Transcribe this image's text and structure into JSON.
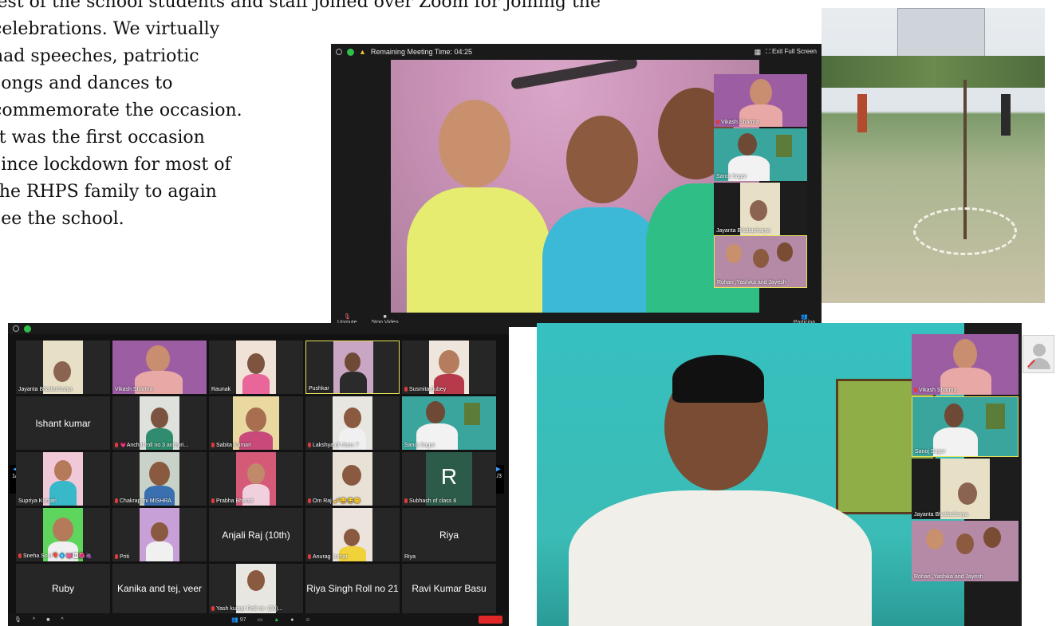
{
  "article": {
    "lines": [
      "rest of the school students and staff joined over Zoom for joining the",
      "celebrations. We virtually",
      "had speeches, patriotic",
      "songs and dances to",
      "commemorate the occasion.",
      "It was the first occasion",
      "since lockdown for most of",
      "the RHPS family to again",
      "see the school."
    ]
  },
  "meeting_top": {
    "remaining_time": "Remaining Meeting Time: 04:25",
    "exit_label": "Exit Full Screen",
    "unmute_label": "Unmute",
    "stop_video_label": "Stop Video",
    "participants_label": "Participa",
    "side_tiles": [
      {
        "name": "Vikash Sharma"
      },
      {
        "name": "Sanoj Sagar"
      },
      {
        "name": "Jayanta Bhattacharya"
      },
      {
        "name": "Rohan ,Yashika and Jayesh"
      }
    ]
  },
  "gallery": {
    "page_left": "1/3",
    "page_right": "1/3",
    "participant_count": "97",
    "tiles": [
      {
        "name": "Jayanta Bhattacharya",
        "label": ""
      },
      {
        "name": "Vikash Sharma",
        "label": ""
      },
      {
        "name": "Raunak",
        "label": ""
      },
      {
        "name": "Pushkar",
        "label": ""
      },
      {
        "name": "Susmita dubey",
        "label": ""
      },
      {
        "name": "",
        "label": "Ishant kumar"
      },
      {
        "name": "💗Anchal roll no 3 and pri...",
        "label": ""
      },
      {
        "name": "Sabita Kumari",
        "label": ""
      },
      {
        "name": "Lakshya of class 7",
        "label": ""
      },
      {
        "name": "Sanoj Sagar",
        "label": ""
      },
      {
        "name": "Supriya Kumari",
        "label": ""
      },
      {
        "name": "Chakrapani MISHRA",
        "label": ""
      },
      {
        "name": "Prabha Bharati",
        "label": ""
      },
      {
        "name": "Om Raj 🎺😀😂😊",
        "label": ""
      },
      {
        "name": "Subhash of class 8",
        "label": "R"
      },
      {
        "name": "Sneha Soni🎈💠💓🅼🌺🍇",
        "label": ""
      },
      {
        "name": "Priti",
        "label": ""
      },
      {
        "name": "",
        "label": "Anjali Raj (10th)"
      },
      {
        "name": "Anurag kumar",
        "label": ""
      },
      {
        "name": "Riya",
        "label": "Riya"
      },
      {
        "name": "",
        "label": "Ruby"
      },
      {
        "name": "",
        "label": "Kanika and tej, veer"
      },
      {
        "name": "Yash kumar Roll no -(30)...",
        "label": ""
      },
      {
        "name": "",
        "label": "Riya Singh Roll no 21"
      },
      {
        "name": "",
        "label": "Ravi Kumar Basu"
      }
    ]
  },
  "meeting_bottom_right": {
    "side_tiles": [
      {
        "name": "Vikash Sharma"
      },
      {
        "name": "Sanoj Sagar"
      },
      {
        "name": "Jayanta Bhattacharya"
      },
      {
        "name": "Rohan ,Yashika and Jayesh"
      }
    ]
  },
  "colors": {
    "zoom_dark": "#1a1a1a",
    "tile_dark": "#262626",
    "active_speaker": "#e8e25a",
    "mic_muted": "#e03b3b",
    "leave_button": "#e02828",
    "shield_green": "#2fbf4a"
  }
}
